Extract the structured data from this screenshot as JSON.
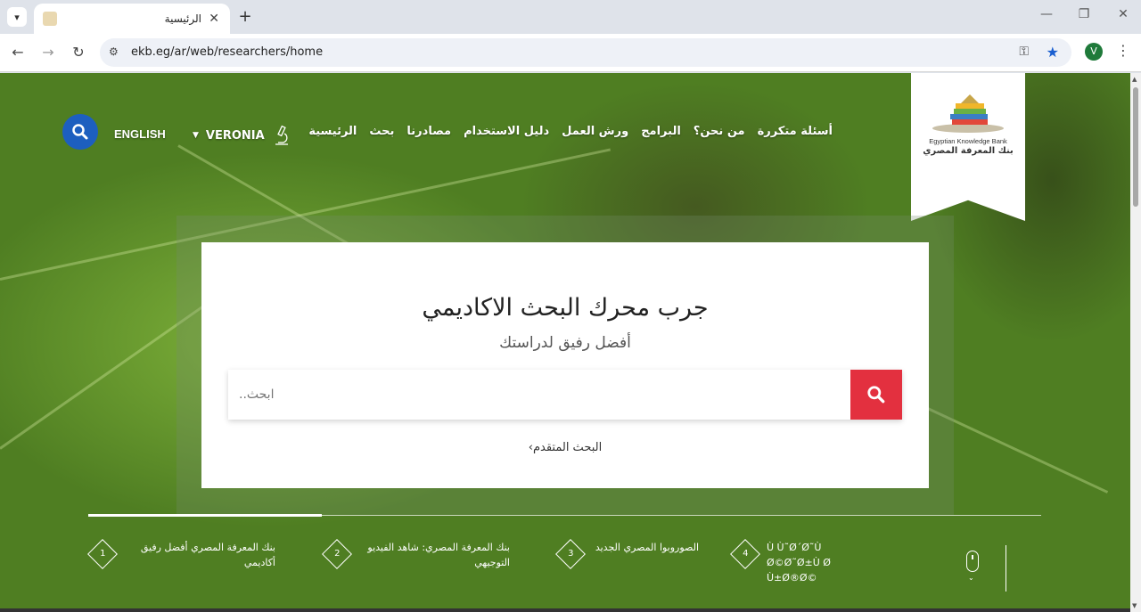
{
  "browser": {
    "tab_title": "الرئيسية",
    "url": "ekb.eg/ar/web/researchers/home",
    "avatar_letter": "V"
  },
  "logo": {
    "english": "Egyptian Knowledge Bank",
    "arabic": "بنك المعرفة المصري"
  },
  "nav": {
    "items": [
      "الرئيسية",
      "بحث",
      "مصادرنا",
      "دليل الاستخدام",
      "ورش العمل",
      "البرامج",
      "من نحن؟",
      "أسئلة متكررة"
    ],
    "user_name": "VERONIA",
    "language": "ENGLISH"
  },
  "hero": {
    "title": "جرب محرك البحث الاكاديمي",
    "subtitle": "أفضل رفيق لدراستك",
    "search_placeholder": "ابحث..",
    "advanced_search": "البحث المتقدم›"
  },
  "slider": {
    "progress": 0.245,
    "items": [
      {
        "num": "1",
        "text": "بنك المعرفة المصري أفضل رفيق أكاديمي"
      },
      {
        "num": "2",
        "text": "بنك المعرفة المصري: شاهد الفيديو التوجيهي"
      },
      {
        "num": "3",
        "text": "الصوروبوا المصري الجديد"
      },
      {
        "num": "4",
        "text": "Ù Ù˜Ø´Ø˜Ù Ø©Ø˜Ø±Ù Ø Ù±Ø®Ø©"
      }
    ]
  },
  "colors": {
    "accent_blue": "#1d5fbf",
    "search_red": "#e3303f"
  }
}
